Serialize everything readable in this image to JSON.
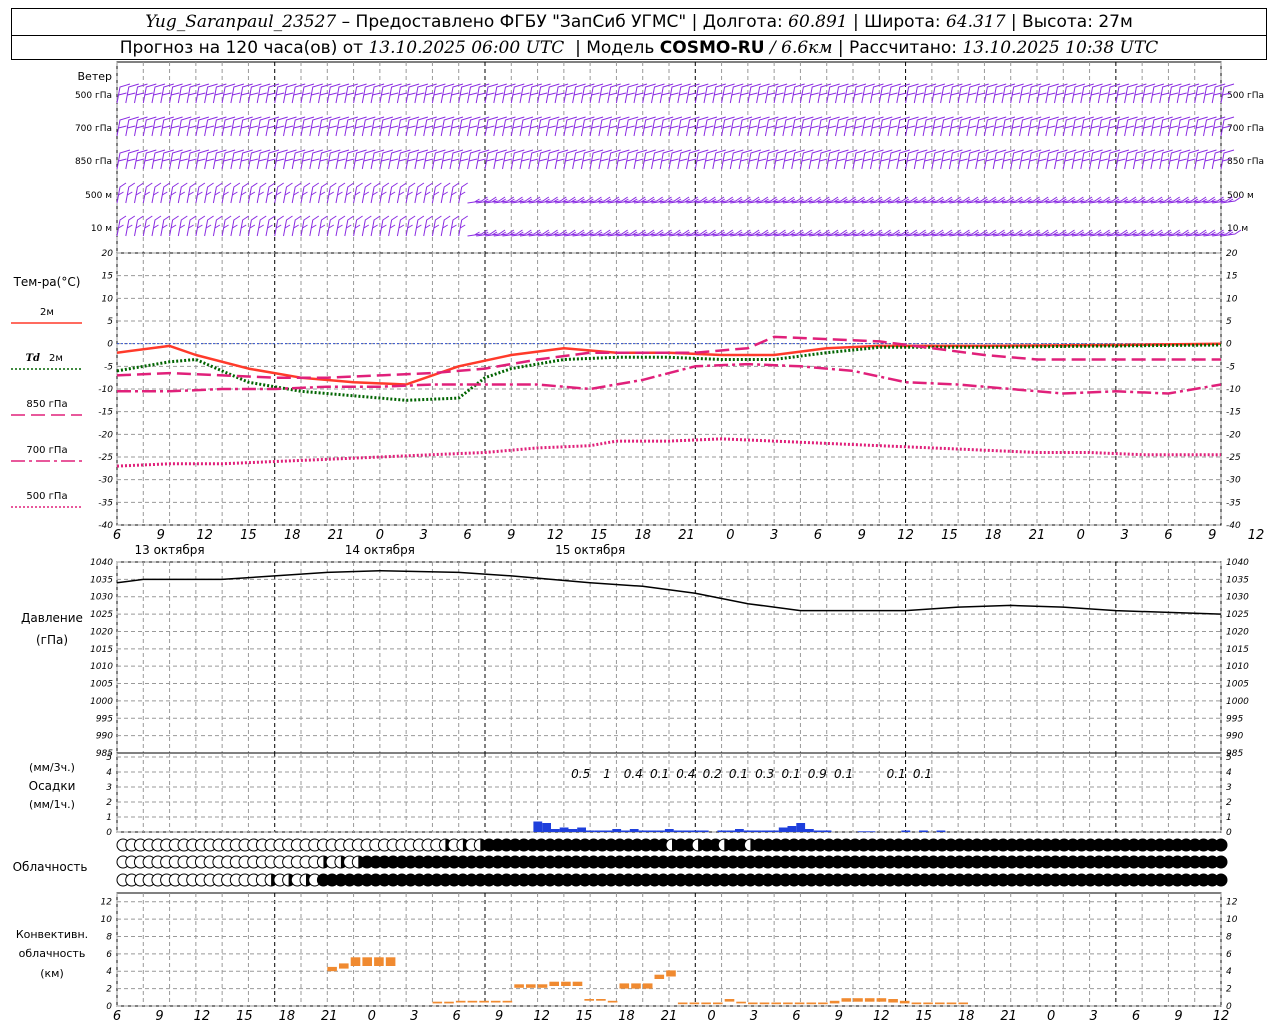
{
  "header": {
    "station": "Yug_Saranpaul_23527",
    "provider": "– Предоставлено ФГБУ \"ЗапСиб УГМС\"",
    "lon_label": "| Долгота:",
    "lon": "60.891",
    "lat_label": "| Широта:",
    "lat": "64.317",
    "alt_label": "| Высота:",
    "alt": "27м",
    "forecast_label": "Прогноз на 120 часа(ов) от",
    "forecast_time": "13.10.2025 06:00 UTC",
    "model_label": "| Модель",
    "model": "COSMO-RU",
    "resolution": "/ 6.6км",
    "calc_label": "| Рассчитано:",
    "calc_time": "13.10.2025 10:38 UTC"
  },
  "chart_data": {
    "type": "meteogram",
    "time_axis": {
      "hours": [
        "6",
        "9",
        "12",
        "15",
        "18",
        "21",
        "0",
        "3",
        "6",
        "9",
        "12",
        "15",
        "18",
        "21",
        "0",
        "3",
        "6",
        "9",
        "12",
        "15",
        "18",
        "21",
        "0",
        "3",
        "6",
        "9",
        "12"
      ],
      "days": [
        {
          "label": "13 октября",
          "at_hour_index": 2
        },
        {
          "label": "14 октября",
          "at_hour_index": 10
        },
        {
          "label": "15 октября",
          "at_hour_index": 18
        }
      ]
    },
    "wind": {
      "title": "Ветер",
      "levels": [
        "500 гПа",
        "700 гПа",
        "850 гПа",
        "500 м",
        "10  м"
      ],
      "barb_color": "#8a2be2",
      "step_hours": 1
    },
    "temperature": {
      "title": "Тем-ра(°C)",
      "ylim": [
        -40,
        20
      ],
      "ticks": [
        20,
        15,
        10,
        5,
        0,
        -5,
        -10,
        -15,
        -20,
        -25,
        -30,
        -35,
        -40
      ],
      "series": [
        {
          "name": "2м",
          "color": "#ff3a2a",
          "style": "solid",
          "width": 2.5,
          "points": [
            [
              0,
              -2
            ],
            [
              6,
              -0.5
            ],
            [
              9,
              -2.5
            ],
            [
              15,
              -5.5
            ],
            [
              21,
              -7.5
            ],
            [
              27,
              -8.5
            ],
            [
              33,
              -9
            ],
            [
              39,
              -5
            ],
            [
              45,
              -2.5
            ],
            [
              51,
              -1
            ],
            [
              57,
              -2
            ],
            [
              63,
              -2
            ],
            [
              69,
              -2.5
            ],
            [
              75,
              -2.5
            ],
            [
              81,
              -1
            ],
            [
              87,
              -0.5
            ],
            [
              99,
              -0.5
            ],
            [
              114,
              -0.3
            ],
            [
              126,
              0
            ]
          ]
        },
        {
          "name": "Td 2м",
          "label_italic": "Td",
          "color": "#006400",
          "style": "dotted",
          "width": 3,
          "points": [
            [
              0,
              -6
            ],
            [
              6,
              -4
            ],
            [
              9,
              -3.5
            ],
            [
              12,
              -6
            ],
            [
              15,
              -8.5
            ],
            [
              21,
              -10.5
            ],
            [
              27,
              -11.5
            ],
            [
              33,
              -12.5
            ],
            [
              39,
              -12
            ],
            [
              42,
              -7.5
            ],
            [
              45,
              -5.5
            ],
            [
              51,
              -3.5
            ],
            [
              57,
              -3
            ],
            [
              63,
              -3
            ],
            [
              69,
              -3.5
            ],
            [
              75,
              -3.5
            ],
            [
              81,
              -2
            ],
            [
              87,
              -0.8
            ],
            [
              99,
              -0.8
            ],
            [
              114,
              -0.5
            ],
            [
              126,
              -0.3
            ]
          ]
        },
        {
          "name": "850 гПа",
          "color": "#e0207a",
          "style": "dashed",
          "width": 2.5,
          "points": [
            [
              0,
              -7
            ],
            [
              6,
              -6.5
            ],
            [
              12,
              -7
            ],
            [
              18,
              -7.5
            ],
            [
              24,
              -7.5
            ],
            [
              30,
              -7
            ],
            [
              36,
              -6.5
            ],
            [
              42,
              -5.5
            ],
            [
              48,
              -3.5
            ],
            [
              54,
              -2
            ],
            [
              60,
              -2
            ],
            [
              66,
              -2
            ],
            [
              72,
              -1
            ],
            [
              75,
              1.5
            ],
            [
              81,
              1
            ],
            [
              87,
              0.5
            ],
            [
              93,
              -1
            ],
            [
              99,
              -2.5
            ],
            [
              105,
              -3.5
            ],
            [
              111,
              -3.5
            ],
            [
              117,
              -3.5
            ],
            [
              126,
              -3.5
            ]
          ]
        },
        {
          "name": "700 гПа",
          "color": "#e0207a",
          "style": "dashdot",
          "width": 2.5,
          "points": [
            [
              0,
              -10.5
            ],
            [
              6,
              -10.5
            ],
            [
              12,
              -10
            ],
            [
              18,
              -10
            ],
            [
              24,
              -9.5
            ],
            [
              30,
              -9.5
            ],
            [
              36,
              -9
            ],
            [
              42,
              -9
            ],
            [
              48,
              -9
            ],
            [
              54,
              -10
            ],
            [
              60,
              -8
            ],
            [
              66,
              -5
            ],
            [
              72,
              -4.5
            ],
            [
              78,
              -5
            ],
            [
              84,
              -6
            ],
            [
              90,
              -8.5
            ],
            [
              96,
              -9
            ],
            [
              102,
              -10
            ],
            [
              108,
              -11
            ],
            [
              114,
              -10.5
            ],
            [
              120,
              -11
            ],
            [
              126,
              -9
            ]
          ]
        },
        {
          "name": "500 гПа",
          "color": "#e0207a",
          "style": "dotted",
          "width": 3,
          "points": [
            [
              0,
              -27
            ],
            [
              6,
              -26.5
            ],
            [
              12,
              -26.5
            ],
            [
              18,
              -26
            ],
            [
              24,
              -25.5
            ],
            [
              30,
              -25
            ],
            [
              36,
              -24.5
            ],
            [
              42,
              -24
            ],
            [
              48,
              -23
            ],
            [
              54,
              -22.5
            ],
            [
              57,
              -21.5
            ],
            [
              63,
              -21.5
            ],
            [
              69,
              -21
            ],
            [
              75,
              -21.5
            ],
            [
              81,
              -22
            ],
            [
              87,
              -22.5
            ],
            [
              93,
              -23
            ],
            [
              99,
              -23.5
            ],
            [
              105,
              -24
            ],
            [
              111,
              -24
            ],
            [
              117,
              -24.5
            ],
            [
              126,
              -24.5
            ]
          ]
        }
      ]
    },
    "pressure": {
      "title": "Давление",
      "unit": "(гПа)",
      "ylim": [
        985,
        1040
      ],
      "ticks": [
        1040,
        1035,
        1030,
        1025,
        1020,
        1015,
        1010,
        1005,
        1000,
        995,
        990,
        985
      ],
      "color": "#000000",
      "points": [
        [
          0,
          1034
        ],
        [
          3,
          1035
        ],
        [
          12,
          1035
        ],
        [
          18,
          1036
        ],
        [
          24,
          1037
        ],
        [
          30,
          1037.5
        ],
        [
          39,
          1037
        ],
        [
          45,
          1036
        ],
        [
          54,
          1034
        ],
        [
          60,
          1033
        ],
        [
          66,
          1031
        ],
        [
          72,
          1028
        ],
        [
          78,
          1026
        ],
        [
          84,
          1026
        ],
        [
          90,
          1026
        ],
        [
          96,
          1027
        ],
        [
          102,
          1027.5
        ],
        [
          108,
          1027
        ],
        [
          114,
          1026
        ],
        [
          120,
          1025.5
        ],
        [
          126,
          1025
        ]
      ]
    },
    "precipitation": {
      "title": "Осадки",
      "unit_3h": "(мм/3ч.)",
      "unit_1h": "(мм/1ч.)",
      "ylim": [
        0,
        5
      ],
      "ticks": [
        5,
        4,
        3,
        2,
        1,
        0
      ],
      "color": "#1e3fdc",
      "labels": [
        {
          "hour": 60,
          "text": "0.5"
        },
        {
          "hour": 63,
          "text": "1"
        },
        {
          "hour": 66,
          "text": "0.4"
        },
        {
          "hour": 69,
          "text": "0.1"
        },
        {
          "hour": 72,
          "text": "0.4"
        },
        {
          "hour": 75,
          "text": "0.2"
        },
        {
          "hour": 78,
          "text": "0.1"
        },
        {
          "hour": 81,
          "text": "0.3"
        },
        {
          "hour": 84,
          "text": "0.1"
        },
        {
          "hour": 87,
          "text": "0.9"
        },
        {
          "hour": 90,
          "text": "0.1"
        },
        {
          "hour": 96,
          "text": "0.1"
        },
        {
          "hour": 99,
          "text": "0.1"
        }
      ],
      "bars": [
        [
          57,
          0.7
        ],
        [
          58,
          0.6
        ],
        [
          59,
          0.2
        ],
        [
          60,
          0.3
        ],
        [
          61,
          0.2
        ],
        [
          62,
          0.3
        ],
        [
          63,
          0.1
        ],
        [
          64,
          0.1
        ],
        [
          65,
          0.1
        ],
        [
          66,
          0.2
        ],
        [
          67,
          0.1
        ],
        [
          68,
          0.2
        ],
        [
          69,
          0.1
        ],
        [
          70,
          0.1
        ],
        [
          71,
          0.1
        ],
        [
          72,
          0.2
        ],
        [
          73,
          0.1
        ],
        [
          74,
          0.1
        ],
        [
          75,
          0.1
        ],
        [
          76,
          0.1
        ],
        [
          78,
          0.1
        ],
        [
          79,
          0.1
        ],
        [
          80,
          0.2
        ],
        [
          81,
          0.1
        ],
        [
          82,
          0.1
        ],
        [
          83,
          0.1
        ],
        [
          84,
          0.1
        ],
        [
          85,
          0.3
        ],
        [
          86,
          0.4
        ],
        [
          87,
          0.6
        ],
        [
          88,
          0.2
        ],
        [
          89,
          0.1
        ],
        [
          90,
          0.1
        ],
        [
          94,
          0.05
        ],
        [
          95,
          0.05
        ],
        [
          99,
          0.1
        ],
        [
          101,
          0.1
        ],
        [
          103,
          0.1
        ]
      ]
    },
    "cloudiness": {
      "title": "Облачность",
      "rows": 3,
      "symbol": "octas-circle"
    },
    "convective": {
      "title_line1": "Конвективн.",
      "title_line2": "облачность",
      "unit": "(км)",
      "ylim": [
        0,
        13
      ],
      "ticks": [
        12,
        10,
        8,
        6,
        4,
        2,
        0
      ],
      "color": "#f08a30",
      "bars": [
        [
          21,
          4,
          4.5
        ],
        [
          22,
          4.3,
          4.9
        ],
        [
          23,
          4.6,
          5.6
        ],
        [
          24,
          4.6,
          5.6
        ],
        [
          25,
          4.6,
          5.6
        ],
        [
          26,
          4.6,
          5.6
        ],
        [
          30,
          0.3,
          0.5
        ],
        [
          31,
          0.3,
          0.5
        ],
        [
          32,
          0.4,
          0.6
        ],
        [
          33,
          0.4,
          0.6
        ],
        [
          34,
          0.4,
          0.6
        ],
        [
          35,
          0.4,
          0.6
        ],
        [
          36,
          0.4,
          0.6
        ],
        [
          37,
          2.1,
          2.5
        ],
        [
          38,
          2.1,
          2.5
        ],
        [
          39,
          2.1,
          2.5
        ],
        [
          40,
          2.3,
          2.8
        ],
        [
          41,
          2.3,
          2.8
        ],
        [
          42,
          2.3,
          2.8
        ],
        [
          43,
          0.6,
          0.8
        ],
        [
          44,
          0.6,
          0.8
        ],
        [
          45,
          0.4,
          0.6
        ],
        [
          46,
          2.0,
          2.6
        ],
        [
          47,
          2.0,
          2.6
        ],
        [
          48,
          2.0,
          2.6
        ],
        [
          49,
          3.1,
          3.6
        ],
        [
          50,
          3.4,
          4.1
        ],
        [
          51,
          0.2,
          0.4
        ],
        [
          52,
          0.2,
          0.4
        ],
        [
          53,
          0.2,
          0.4
        ],
        [
          54,
          0.2,
          0.4
        ],
        [
          55,
          0.5,
          0.8
        ],
        [
          56,
          0.3,
          0.5
        ],
        [
          57,
          0.2,
          0.4
        ],
        [
          58,
          0.2,
          0.4
        ],
        [
          59,
          0.2,
          0.4
        ],
        [
          60,
          0.2,
          0.4
        ],
        [
          61,
          0.2,
          0.4
        ],
        [
          62,
          0.2,
          0.4
        ],
        [
          63,
          0.2,
          0.4
        ],
        [
          64,
          0.3,
          0.6
        ],
        [
          65,
          0.5,
          0.9
        ],
        [
          66,
          0.5,
          0.9
        ],
        [
          67,
          0.5,
          0.9
        ],
        [
          68,
          0.5,
          0.9
        ],
        [
          69,
          0.4,
          0.8
        ],
        [
          70,
          0.3,
          0.6
        ],
        [
          71,
          0.2,
          0.4
        ],
        [
          72,
          0.2,
          0.4
        ],
        [
          73,
          0.2,
          0.4
        ],
        [
          74,
          0.2,
          0.4
        ],
        [
          75,
          0.2,
          0.4
        ]
      ]
    }
  }
}
